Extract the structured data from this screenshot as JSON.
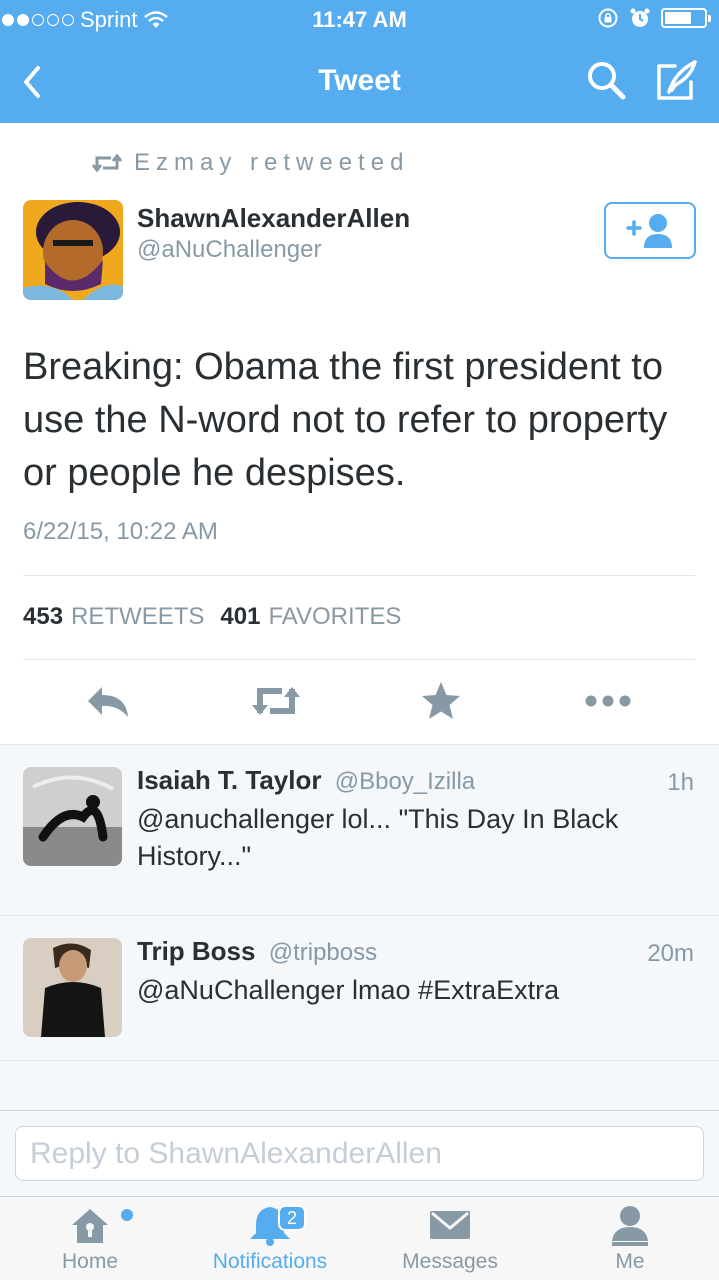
{
  "status_bar": {
    "carrier": "Sprint",
    "time": "11:47 AM"
  },
  "nav": {
    "title": "Tweet"
  },
  "retweet_context": {
    "text": "Ezmay retweeted"
  },
  "tweet": {
    "author_name": "ShawnAlexanderAllen",
    "author_handle": "@aNuChallenger",
    "text": "Breaking: Obama the first president to use the N-word not to refer to property or people he despises.",
    "timestamp": "6/22/15, 10:22 AM",
    "retweets_count": "453",
    "retweets_label": "RETWEETS",
    "favorites_count": "401",
    "favorites_label": "FAVORITES"
  },
  "replies": [
    {
      "name": "Isaiah T. Taylor",
      "handle": "@Bboy_Izilla",
      "time": "1h",
      "text": "@anuchallenger lol... \"This Day In Black History...\""
    },
    {
      "name": "Trip Boss",
      "handle": "@tripboss",
      "time": "20m",
      "text": "@aNuChallenger lmao #ExtraExtra"
    }
  ],
  "reply_box": {
    "placeholder": "Reply to ShawnAlexanderAllen"
  },
  "tabs": [
    {
      "label": "Home",
      "icon": "home-icon",
      "active": false
    },
    {
      "label": "Notifications",
      "icon": "bell-icon",
      "active": true,
      "badge": "2"
    },
    {
      "label": "Messages",
      "icon": "envelope-icon",
      "active": false
    },
    {
      "label": "Me",
      "icon": "person-icon",
      "active": false
    }
  ],
  "colors": {
    "accent": "#55acee",
    "text": "#292f33",
    "muted": "#8899a6"
  }
}
